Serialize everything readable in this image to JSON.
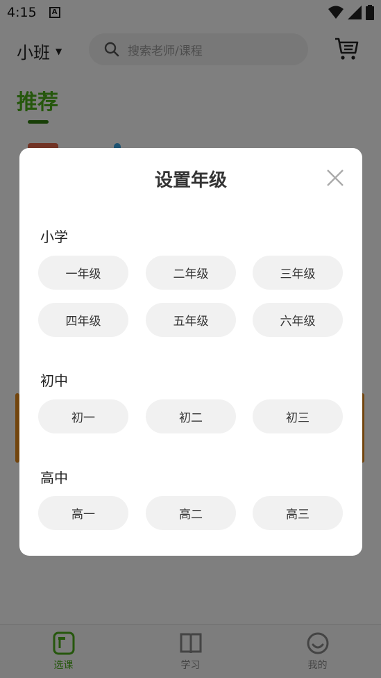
{
  "status_bar": {
    "time": "4:15",
    "notification_glyph": "A"
  },
  "header": {
    "grade_label": "小班",
    "search_placeholder": "搜索老师/课程"
  },
  "tabs": {
    "recommend": "推荐"
  },
  "dialog": {
    "title": "设置年级",
    "sections": [
      {
        "label": "小学",
        "grades": [
          "一年级",
          "二年级",
          "三年级",
          "四年级",
          "五年级",
          "六年级"
        ]
      },
      {
        "label": "初中",
        "grades": [
          "初一",
          "初二",
          "初三"
        ]
      },
      {
        "label": "高中",
        "grades": [
          "高一",
          "高二",
          "高三"
        ]
      }
    ]
  },
  "bottom_nav": {
    "items": [
      {
        "label": "选课",
        "active": true
      },
      {
        "label": "学习",
        "active": false
      },
      {
        "label": "我的",
        "active": false
      }
    ]
  },
  "colors": {
    "accent": "#4caf1a",
    "overlay": "rgba(0,0,0,0.5)"
  }
}
